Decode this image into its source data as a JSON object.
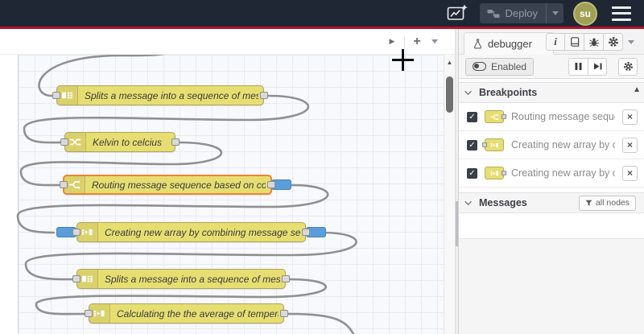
{
  "header": {
    "deploy_label": "Deploy",
    "avatar_initials": "su",
    "icons": {
      "left_button": "export-flows-icon",
      "deploy": "deploy-nodes-icon",
      "menu": "hamburger-icon"
    }
  },
  "glyphs": {
    "close": "×",
    "play": "▶",
    "plus": "+",
    "up_arrow": "▲",
    "check": "✓",
    "info": "i"
  },
  "canvas": {
    "toolbar_icons": [
      "scroll-tabs-play-icon",
      "add-flow-icon",
      "flow-list-caret-icon"
    ],
    "nodes": [
      {
        "type": "split",
        "icon": "split-icon",
        "label": "Splits a message into a sequence of messages."
      },
      {
        "type": "change",
        "icon": "shuffle-icon",
        "label": "Kelvin to celcius"
      },
      {
        "type": "switch",
        "icon": "switch-icon",
        "label": "Routing message sequence based on condition",
        "selected": true,
        "breakpoint_output": true
      },
      {
        "type": "join",
        "icon": "join-icon",
        "label": "Creating new array by combining message sequence",
        "breakpoint_input": true,
        "breakpoint_output": true
      },
      {
        "type": "split",
        "icon": "split-icon",
        "label": "Splits a message into a sequence of messages."
      },
      {
        "type": "join",
        "icon": "join-icon",
        "label": "Calculating the the average of temperature"
      }
    ]
  },
  "sidebar": {
    "tab_label": "debugger",
    "tab_icon": "flask-icon",
    "toolbar_icons": [
      "info-icon",
      "library-icon",
      "bug-icon",
      "gear-icon",
      "caret-down-icon"
    ],
    "debug_toolbar": {
      "enabled_label": "Enabled",
      "icons": [
        "pause-icon",
        "step-icon",
        "gear-icon"
      ]
    },
    "breakpoints": {
      "title": "Breakpoints",
      "items": [
        {
          "checked": true,
          "node_icon": "switch",
          "port_side": "right",
          "label": "Routing message sequence ba"
        },
        {
          "checked": true,
          "node_icon": "join",
          "port_side": "left",
          "label": "Creating new array by combini"
        },
        {
          "checked": true,
          "node_icon": "join",
          "port_side": "right",
          "label": "Creating new array by combini"
        }
      ]
    },
    "messages": {
      "title": "Messages",
      "filter_label": "all nodes"
    }
  },
  "colors": {
    "header_bg": "#1f2734",
    "deploy_warning_red": "#b2122b",
    "node_yellow": "#e7de72",
    "node_border": "#aca45c",
    "selected_orange": "#ee8331",
    "breakpoint_blue": "#5b9dd9",
    "wire_gray": "#909090",
    "avatar_olive": "#a0a054"
  }
}
